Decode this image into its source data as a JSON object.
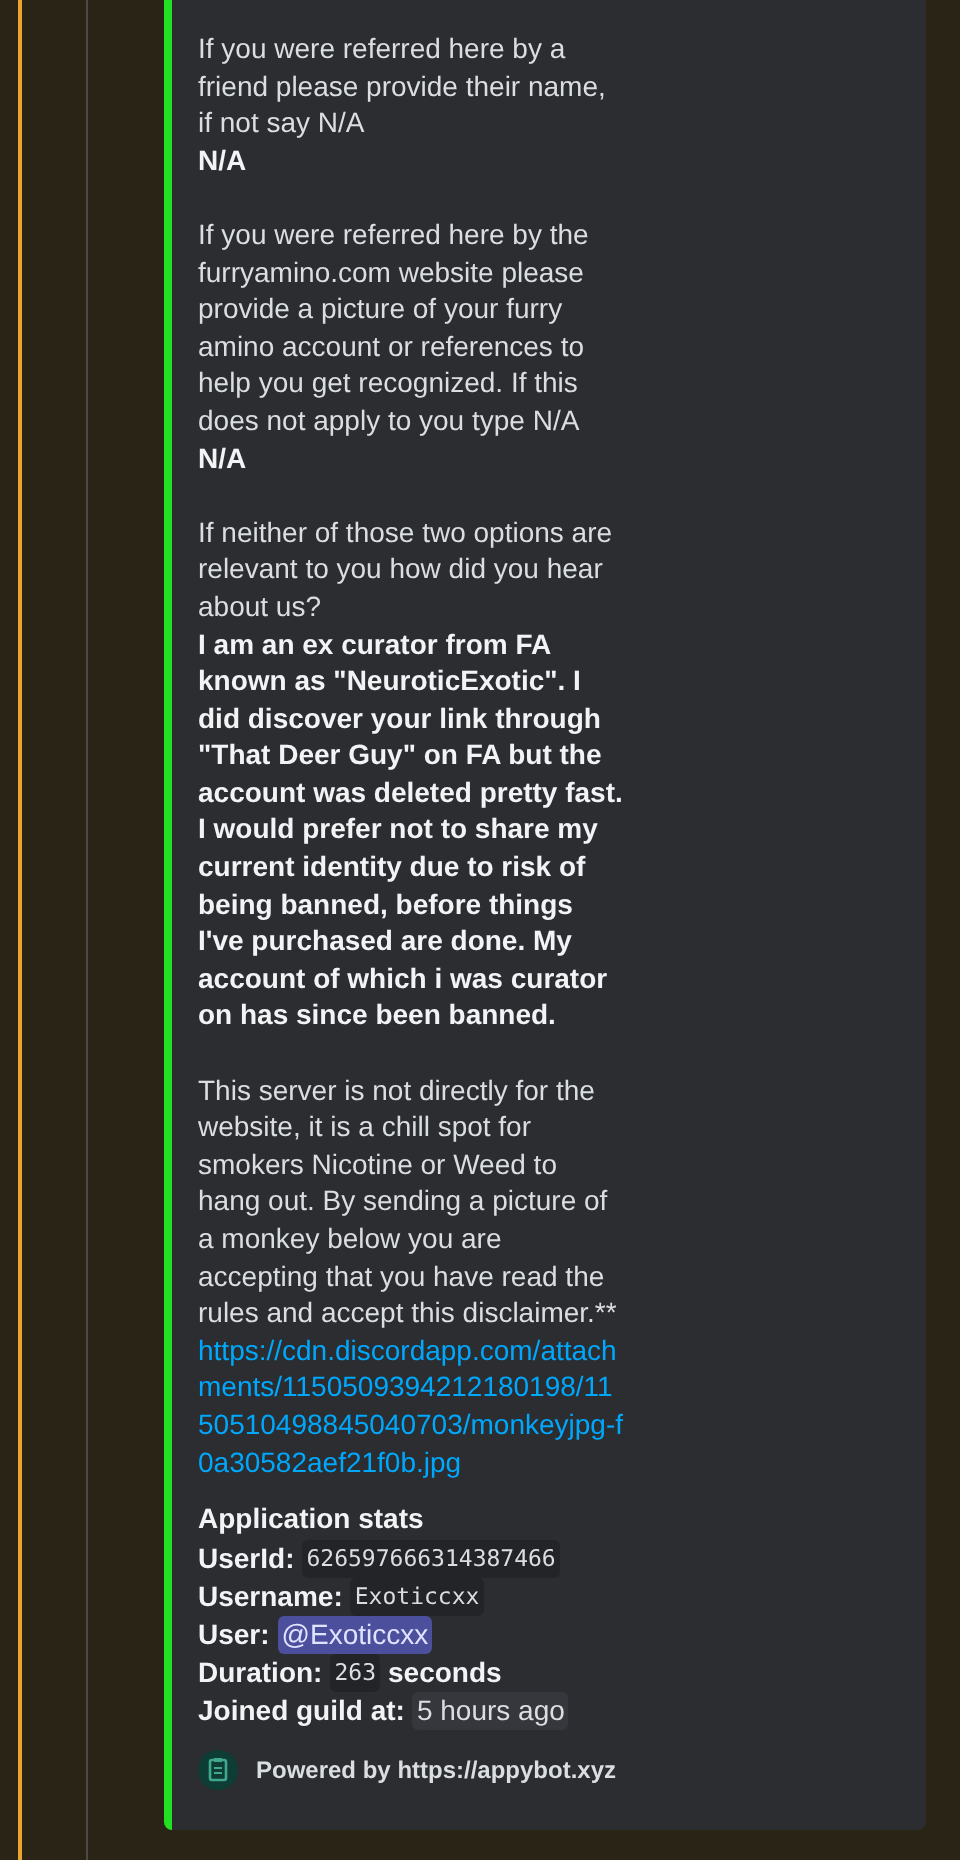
{
  "embed": {
    "fields": [
      {
        "question": "If you were referred here by a friend please provide their name, if not say N/A",
        "answer": "N/A"
      },
      {
        "question": "If you were referred here by the furryamino.com website please provide a picture of your furry amino account or references to help you get recognized. If this does not apply to you type N/A",
        "answer": "N/A"
      },
      {
        "question": "If neither of those two options are relevant to you how did you hear about us?",
        "answer": "I am an ex curator from FA known as \"NeuroticExotic\". I did discover your link through \"That Deer Guy\" on FA but the account was deleted pretty fast. I would prefer not to share my current identity due to risk of being banned, before things I've purchased are done. My account of which i was curator on has since been banned."
      }
    ],
    "disclaimer": "This server is not directly for the website, it is a chill spot for smokers Nicotine or Weed to hang out. By sending a picture of a monkey below you are accepting that you have read the rules and accept this disclaimer.**",
    "link": "https://cdn.discordapp.com/attachments/1150509394212180198/1150510498845040703/monkeyjpg-f0a30582aef21f0b.jpg",
    "stats_title": "Application stats",
    "stats": [
      {
        "label": "UserId:",
        "value": "626597666314387466",
        "kind": "code"
      },
      {
        "label": "Username:",
        "value": "Exoticcxx",
        "kind": "code"
      },
      {
        "label": "User:",
        "value": "@Exoticcxx",
        "kind": "mention"
      },
      {
        "label": "Duration:",
        "value": "263",
        "kind": "code",
        "suffix": "seconds"
      },
      {
        "label": "Joined guild at:",
        "value": "5 hours ago",
        "kind": "timestamp"
      }
    ],
    "footer": "Powered by https://appybot.xyz"
  }
}
